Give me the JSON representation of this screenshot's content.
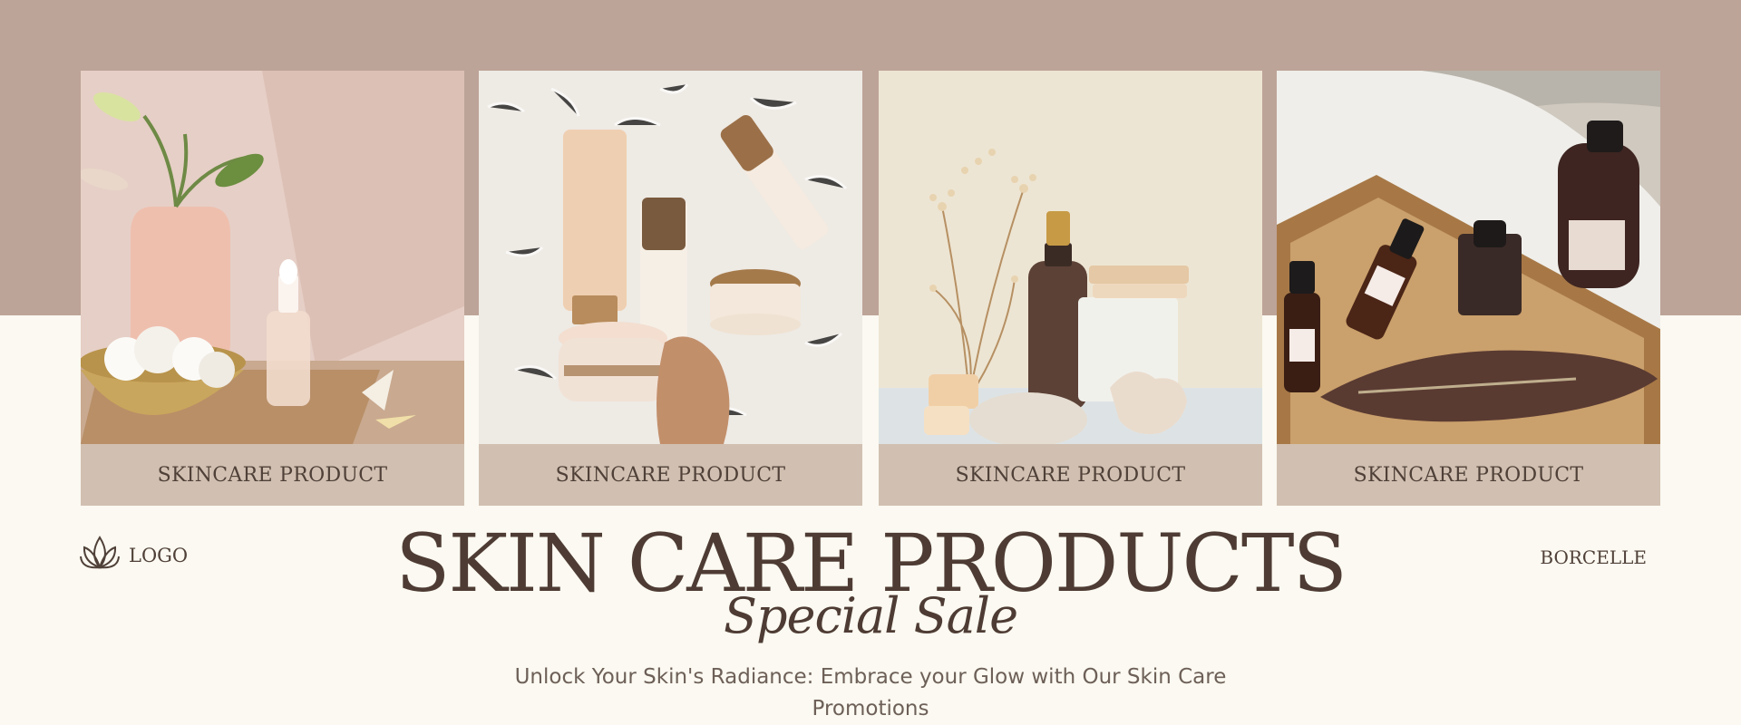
{
  "cards": [
    {
      "caption": "SKINCARE PRODUCT",
      "image": "dropper-bottle-with-lily-and-cotton"
    },
    {
      "caption": "SKINCARE PRODUCT",
      "image": "cream-tubes-and-jars-on-white-fur"
    },
    {
      "caption": "SKINCARE PRODUCT",
      "image": "amber-spray-bottle-with-dried-flowers"
    },
    {
      "caption": "SKINCARE PRODUCT",
      "image": "serum-bottles-on-wooden-tray"
    }
  ],
  "logo": {
    "text": "LOGO",
    "icon": "lotus-icon"
  },
  "brand": "BORCELLE",
  "title": "SKIN CARE PRODUCTS",
  "subtitle": "Special Sale",
  "tagline": "Unlock Your Skin's Radiance: Embrace your Glow with Our Skin Care Promotions",
  "colors": {
    "band": "#bda498",
    "background": "#fbf9f1",
    "caption_bg": "#d1c0b1",
    "text": "#4e3c34"
  }
}
